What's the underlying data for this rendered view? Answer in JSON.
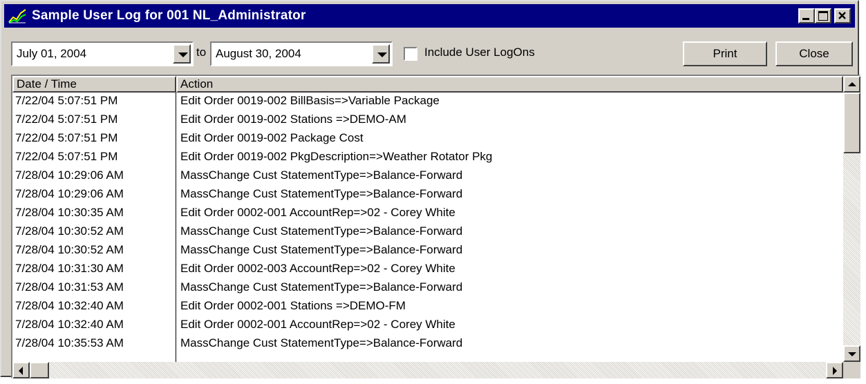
{
  "window": {
    "title": "Sample User Log for 001 NL_Administrator",
    "controls": {
      "minimize": "minimize-icon",
      "maximize": "maximize-icon",
      "close": "close-icon"
    }
  },
  "toolbar": {
    "from_date": "July 01, 2004",
    "to_label": "to",
    "to_date": "August 30, 2004",
    "include_logons_label": "Include User LogOns",
    "include_logons_checked": false,
    "print_label": "Print",
    "close_label": "Close"
  },
  "log_table": {
    "columns": [
      "Date / Time",
      "Action"
    ],
    "rows": [
      [
        "7/22/04 5:07:51 PM",
        "Edit Order 0019-002 BillBasis=>Variable Package"
      ],
      [
        "7/22/04 5:07:51 PM",
        "Edit Order 0019-002 Stations =>DEMO-AM"
      ],
      [
        "7/22/04 5:07:51 PM",
        "Edit Order 0019-002 Package Cost"
      ],
      [
        "7/22/04 5:07:51 PM",
        "Edit Order 0019-002 PkgDescription=>Weather Rotator Pkg"
      ],
      [
        "7/28/04 10:29:06 AM",
        "MassChange Cust StatementType=>Balance-Forward"
      ],
      [
        "7/28/04 10:29:06 AM",
        "MassChange Cust StatementType=>Balance-Forward"
      ],
      [
        "7/28/04 10:30:35 AM",
        "Edit Order 0002-001 AccountRep=>02 - Corey White"
      ],
      [
        "7/28/04 10:30:52 AM",
        "MassChange Cust StatementType=>Balance-Forward"
      ],
      [
        "7/28/04 10:30:52 AM",
        "MassChange Cust StatementType=>Balance-Forward"
      ],
      [
        "7/28/04 10:31:30 AM",
        "Edit Order 0002-003 AccountRep=>02 - Corey White"
      ],
      [
        "7/28/04 10:31:53 AM",
        "MassChange Cust StatementType=>Balance-Forward"
      ],
      [
        "7/28/04 10:32:40 AM",
        "Edit Order 0002-001 Stations =>DEMO-FM"
      ],
      [
        "7/28/04 10:32:40 AM",
        "Edit Order 0002-001 AccountRep=>02 - Corey White"
      ],
      [
        "7/28/04 10:35:53 AM",
        "MassChange Cust StatementType=>Balance-Forward"
      ]
    ]
  },
  "colors": {
    "titlebar": "#000080",
    "face": "#d4d0c8",
    "list_bg": "#ffffff"
  }
}
